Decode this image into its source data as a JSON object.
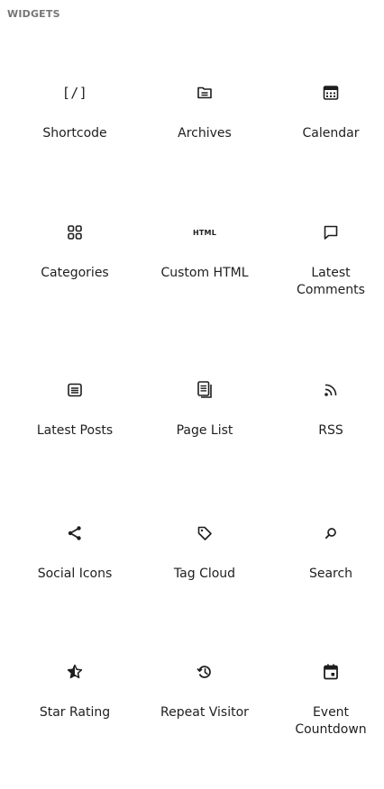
{
  "panel": {
    "title": "WIDGETS"
  },
  "blocks": [
    {
      "label": "Shortcode",
      "icon": "shortcode-icon",
      "icon_text": "[/]"
    },
    {
      "label": "Archives",
      "icon": "archive-folder-icon"
    },
    {
      "label": "Calendar",
      "icon": "calendar-icon"
    },
    {
      "label": "Categories",
      "icon": "categories-grid-icon"
    },
    {
      "label": "Custom HTML",
      "icon": "html-icon",
      "icon_text": "HTML"
    },
    {
      "label": "Latest\nComments",
      "icon": "comment-icon"
    },
    {
      "label": "Latest Posts",
      "icon": "post-list-icon"
    },
    {
      "label": "Page List",
      "icon": "page-list-icon"
    },
    {
      "label": "RSS",
      "icon": "rss-icon"
    },
    {
      "label": "Social Icons",
      "icon": "share-icon"
    },
    {
      "label": "Tag Cloud",
      "icon": "tag-icon"
    },
    {
      "label": "Search",
      "icon": "search-icon"
    },
    {
      "label": "Star Rating",
      "icon": "star-icon"
    },
    {
      "label": "Repeat Visitor",
      "icon": "history-icon"
    },
    {
      "label": "Event\nCountdown",
      "icon": "event-calendar-icon"
    }
  ]
}
